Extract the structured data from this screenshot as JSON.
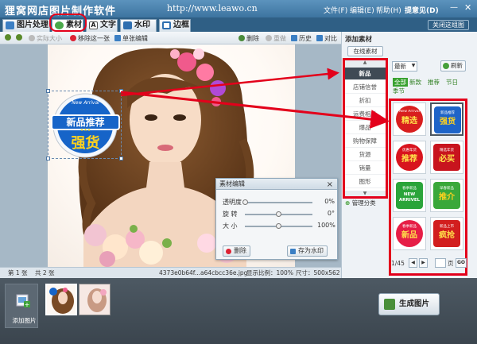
{
  "app": {
    "title": "狸窝网店图片制作软件",
    "url": "http://www.leawo.cn",
    "menus": [
      "文件(F)",
      "编辑(E)",
      "帮助(H)",
      "提意见(D)"
    ]
  },
  "tabs": [
    "图片处理",
    "素材",
    "文字",
    "水印",
    "边框"
  ],
  "close_mode_label": "关闭这组图",
  "toolbar": {
    "actual_size": "实际大小",
    "remove_one": "移除这一张",
    "single_edit": "单张编辑",
    "delete": "删除",
    "redo": "重做",
    "history": "历史",
    "compare": "对比"
  },
  "sticker": {
    "new_arrival": "New Arrival",
    "line1": "新品推荐",
    "stars": "★★★",
    "line2": "强货"
  },
  "material_edit": {
    "title": "素材编辑",
    "close": "×",
    "sliders": [
      {
        "label": "透明度",
        "value": "0%",
        "level": 0.0
      },
      {
        "label": "旋  转",
        "value": "0°",
        "level": 0.5
      },
      {
        "label": "大  小",
        "value": "100%",
        "level": 0.5
      }
    ],
    "delete_label": "删除",
    "save_watermark_label": "存为水印"
  },
  "status": {
    "current": "第 1 张",
    "total": "共 2 张",
    "filename": "4373e0b64f...a64cbcc36e.jpg",
    "ratio": "显示比例：100%",
    "size": "尺寸：500x562"
  },
  "bottom": {
    "add_image": "添加图片",
    "generate": "生成图片"
  },
  "right_panel": {
    "title": "添加素材",
    "online_btn": "在线素材",
    "categories": [
      "新品",
      "店铺信誉",
      "折扣",
      "运费相关",
      "爆品",
      "购物保障",
      "货源",
      "销量",
      "图形"
    ],
    "active_category": "新品",
    "manage": "管理分类",
    "sort_value": "最新",
    "refresh": "刷新",
    "filters": [
      "全部",
      "新款",
      "推荐",
      "节日"
    ],
    "filter_extra": "季节",
    "stickers": [
      {
        "top": "New Arrival",
        "main": "精选",
        "bg": "#d81e1e",
        "fg": "#ffe14a"
      },
      {
        "top": "新品推荐",
        "main": "强货",
        "bg": "#1e64c8",
        "fg": "#ffd21e"
      },
      {
        "top": "优惠年货",
        "main": "推荐",
        "bg": "#d8141e",
        "fg": "#ffe14a"
      },
      {
        "top": "精选年货",
        "main": "必买",
        "bg": "#c8141e",
        "fg": "#ffe14a"
      },
      {
        "top": "春季新品",
        "main": "NEW ARRIVEL",
        "bg": "#2aa43a",
        "fg": "#ffffff"
      },
      {
        "top": "早春新品",
        "main": "推介",
        "bg": "#3aa83a",
        "fg": "#ffd21e"
      },
      {
        "top": "春季新品",
        "main": "新品",
        "bg": "#e61e46",
        "fg": "#ffe14a"
      },
      {
        "top": "新品上市",
        "main": "疯抢",
        "bg": "#d21e1e",
        "fg": "#ffe14a"
      }
    ],
    "pager": {
      "page": "1/45",
      "page_unit": "页",
      "go": "GO"
    }
  }
}
